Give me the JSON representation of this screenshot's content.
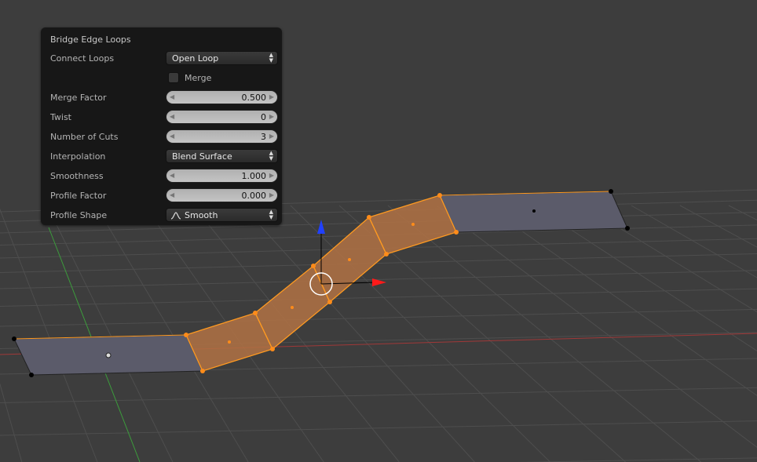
{
  "operator_panel": {
    "title": "Bridge Edge Loops",
    "connect_loops": {
      "label": "Connect Loops",
      "value": "Open Loop"
    },
    "merge": {
      "label": "Merge",
      "checked": false
    },
    "merge_factor": {
      "label": "Merge Factor",
      "value": "0.500"
    },
    "twist": {
      "label": "Twist",
      "value": "0"
    },
    "number_of_cuts": {
      "label": "Number of Cuts",
      "value": "3"
    },
    "interpolation": {
      "label": "Interpolation",
      "value": "Blend Surface"
    },
    "smoothness": {
      "label": "Smoothness",
      "value": "1.000"
    },
    "profile_factor": {
      "label": "Profile Factor",
      "value": "0.000"
    },
    "profile_shape": {
      "label": "Profile Shape",
      "value": "Smooth",
      "icon": "smooth-curve-icon"
    }
  },
  "viewport": {
    "background": "#3d3d3d",
    "selection_color": "#ff8c1a",
    "x_axis_color": "#c83c3c",
    "y_axis_color": "#3c9c3c",
    "z_gizmo_color": "#2040ff"
  }
}
